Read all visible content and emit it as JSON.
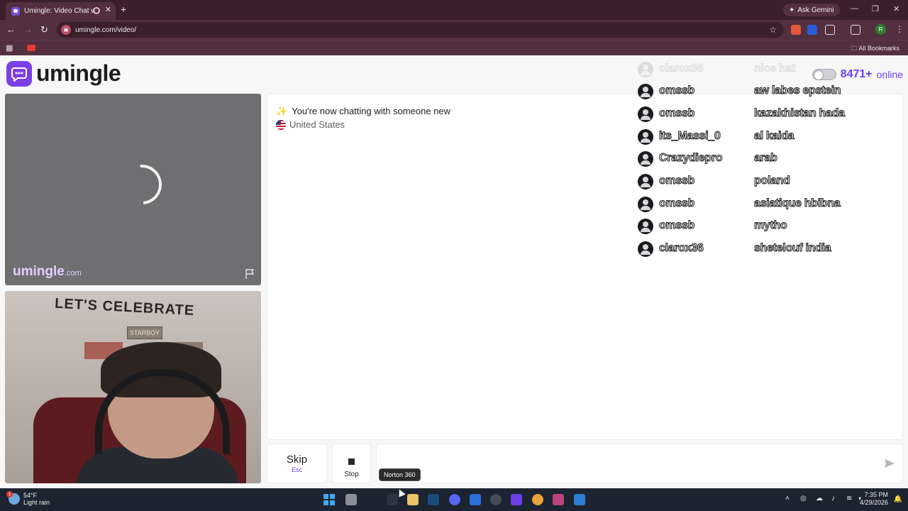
{
  "browser": {
    "tab_title": "Umingle: Video Chat with S",
    "new_tab": "+",
    "close": "✕",
    "ask_gemini": "Ask Gemini",
    "url": "umingle.com/video/",
    "bookmarks_label": "All Bookmarks",
    "profile_initial": "R",
    "window_controls": [
      "—",
      "❐",
      "✕"
    ]
  },
  "site": {
    "logo_text": "umingle",
    "online_count": "8471+",
    "online_label": "online"
  },
  "remote_video": {
    "watermark_main": "umingle",
    "watermark_suffix": ".com"
  },
  "self_video": {
    "banner_text": "LET'S CELEBRATE",
    "poster_text": "STARBOY"
  },
  "chat": {
    "system_message": "You're now chatting with someone new",
    "country": "United States"
  },
  "feed": [
    {
      "user": "clarox36",
      "message": "nice hat",
      "faded": true
    },
    {
      "user": "omssb",
      "message": "aw labes epstein"
    },
    {
      "user": "omssb",
      "message": "kazakhistan hada"
    },
    {
      "user": "its_Massi_0",
      "message": "al kaida"
    },
    {
      "user": "Crazydiepro",
      "message": "arab"
    },
    {
      "user": "omssb",
      "message": "poland"
    },
    {
      "user": "omssb",
      "message": "asiatique hbibna"
    },
    {
      "user": "omssb",
      "message": "mytho"
    },
    {
      "user": "clarox36",
      "message": "shetelouf india"
    }
  ],
  "controls": {
    "skip_label": "Skip",
    "skip_key": "Esc",
    "stop_label": "Stop"
  },
  "tooltip": "Norton 360",
  "taskbar": {
    "weather_temp": "54°F",
    "weather_desc": "Light rain",
    "weather_badge": "1",
    "time": "7:35 PM",
    "date": "4/29/2026"
  },
  "colors": {
    "brand": "#7b3fe4",
    "online_accent": "#6b3ff0",
    "browser_frame": "#3b1f2b"
  }
}
